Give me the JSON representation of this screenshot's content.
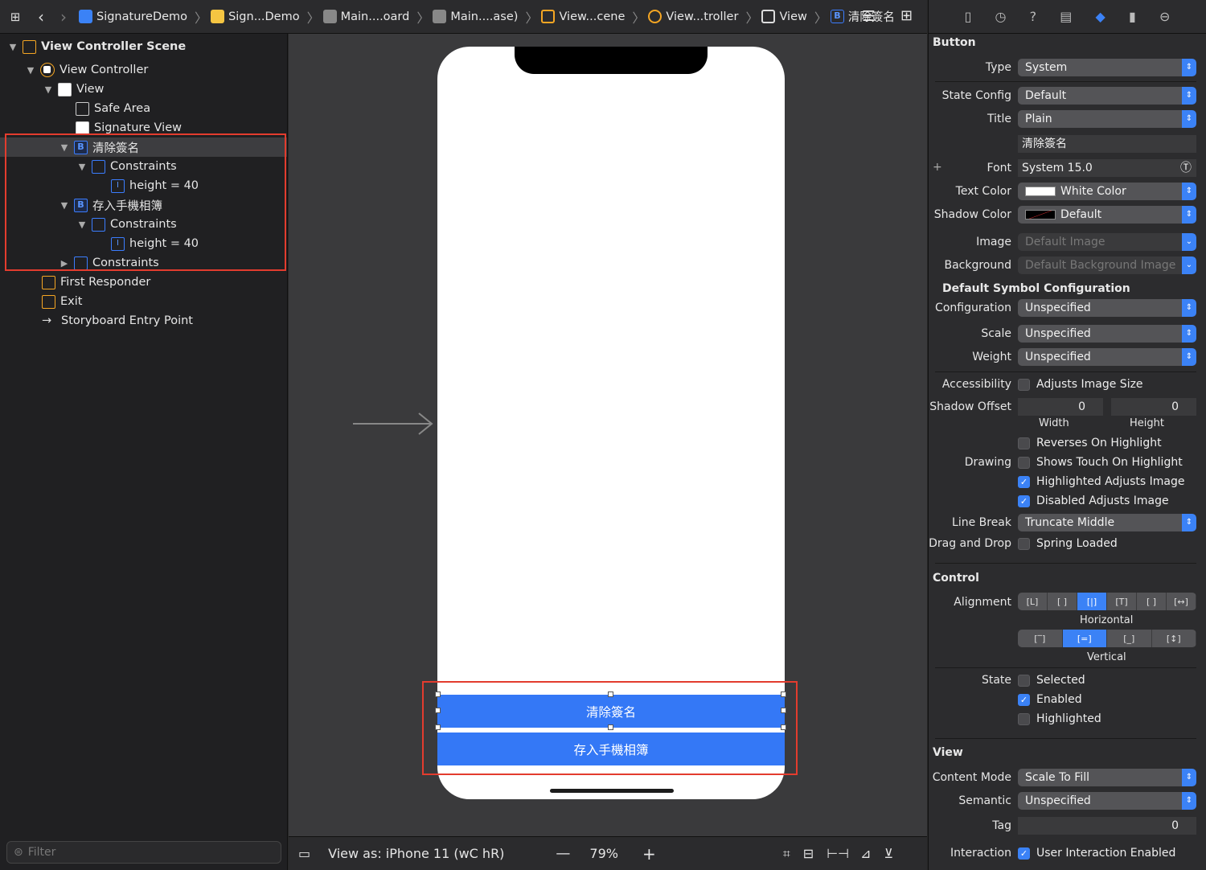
{
  "breadcrumb": [
    "SignatureDemo",
    "Sign...Demo",
    "Main....oard",
    "Main....ase)",
    "View...cene",
    "View...troller",
    "View",
    "清除簽名"
  ],
  "outline": {
    "items": [
      {
        "label": "View Controller Scene",
        "icon": "scene-icon"
      },
      {
        "label": "View Controller",
        "icon": "view-controller-icon"
      },
      {
        "label": "View",
        "icon": "view-icon"
      },
      {
        "label": "Safe Area",
        "icon": "safe-area-icon"
      },
      {
        "label": "Signature View",
        "icon": "view-icon"
      },
      {
        "label": "清除簽名",
        "icon": "button-icon"
      },
      {
        "label": "Constraints",
        "icon": "constraints-icon"
      },
      {
        "label": "height = 40",
        "icon": "height-constraint-icon"
      },
      {
        "label": "存入手機相簿",
        "icon": "button-icon"
      },
      {
        "label": "Constraints",
        "icon": "constraints-icon"
      },
      {
        "label": "height = 40",
        "icon": "height-constraint-icon"
      },
      {
        "label": "Constraints",
        "icon": "constraints-icon"
      },
      {
        "label": "First Responder",
        "icon": "first-responder-icon"
      },
      {
        "label": "Exit",
        "icon": "exit-icon"
      },
      {
        "label": "Storyboard Entry Point",
        "icon": "arrow-right-icon"
      }
    ],
    "filter_placeholder": "Filter"
  },
  "canvas": {
    "button1": "清除簽名",
    "button2": "存入手機相簿"
  },
  "bottombar": {
    "view_as": "View as: iPhone 11 (",
    "wc": "wC hR)",
    "zoom": "79%"
  },
  "inspector": {
    "button_header": "Button",
    "type_label": "Type",
    "type": "System",
    "state_label": "State Config",
    "state": "Default",
    "title_label": "Title",
    "title": "Plain",
    "title_text": "清除簽名",
    "font_label": "Font",
    "font": "System 15.0",
    "text_color_label": "Text Color",
    "text_color": "White Color",
    "shadow_color_label": "Shadow Color",
    "shadow_color": "Default",
    "image_label": "Image",
    "image": "Default Image",
    "background_label": "Background",
    "background": "Default Background Image",
    "symbol_header": "Default Symbol Configuration",
    "configuration_label": "Configuration",
    "configuration": "Unspecified",
    "scale_label": "Scale",
    "scale": "Unspecified",
    "weight_label": "Weight",
    "weight": "Unspecified",
    "accessibility_label": "Accessibility",
    "adjusts_image_size": "Adjusts Image Size",
    "shadow_offset_label": "Shadow Offset",
    "shadow_w": "0",
    "shadow_h": "0",
    "width_label": "Width",
    "height_label": "Height",
    "reverses": "Reverses On Highlight",
    "drawing_label": "Drawing",
    "shows_touch": "Shows Touch On Highlight",
    "highlighted_adjusts": "Highlighted Adjusts Image",
    "disabled_adjusts": "Disabled Adjusts Image",
    "line_break_label": "Line Break",
    "line_break": "Truncate Middle",
    "drag_drop_label": "Drag and Drop",
    "spring_loaded": "Spring Loaded",
    "control_header": "Control",
    "alignment_label": "Alignment",
    "horizontal_label": "Horizontal",
    "vertical_label": "Vertical",
    "state_section_label": "State",
    "selected": "Selected",
    "enabled": "Enabled",
    "highlighted": "Highlighted",
    "view_header": "View",
    "content_mode_label": "Content Mode",
    "content_mode": "Scale To Fill",
    "semantic_label": "Semantic",
    "semantic": "Unspecified",
    "tag_label": "Tag",
    "tag": "0",
    "interaction_label": "Interaction",
    "user_interaction": "User Interaction Enabled"
  },
  "colors": {
    "accent": "#3b82f6",
    "button_blue": "#3478f6",
    "highlight_red": "#e33c2e"
  }
}
